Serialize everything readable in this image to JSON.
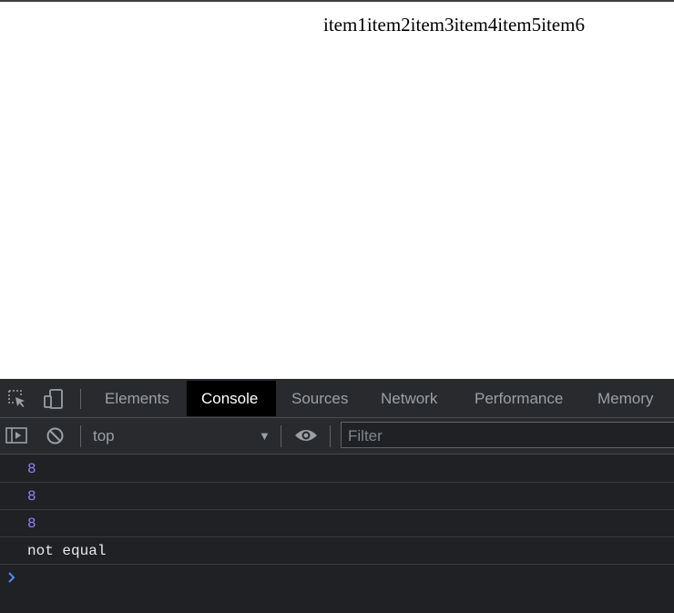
{
  "page": {
    "content_text": "item1item2item3item4item5item6"
  },
  "devtools": {
    "icons": [
      "inspect-element-icon",
      "device-toolbar-icon"
    ],
    "tabs": [
      {
        "label": "Elements",
        "active": false
      },
      {
        "label": "Console",
        "active": true
      },
      {
        "label": "Sources",
        "active": false
      },
      {
        "label": "Network",
        "active": false
      },
      {
        "label": "Performance",
        "active": false
      },
      {
        "label": "Memory",
        "active": false
      }
    ],
    "toolbar": {
      "context": "top",
      "context_arrow": "▼",
      "filter_placeholder": "Filter"
    },
    "console": {
      "lines": [
        {
          "text": "8",
          "kind": "number"
        },
        {
          "text": "8",
          "kind": "number"
        },
        {
          "text": "8",
          "kind": "number"
        },
        {
          "text": "not equal",
          "kind": "string"
        }
      ]
    },
    "colors": {
      "background": "#202124",
      "number": "#9980ff",
      "text": "#e8eaed",
      "prompt": "#4c8df6"
    }
  }
}
